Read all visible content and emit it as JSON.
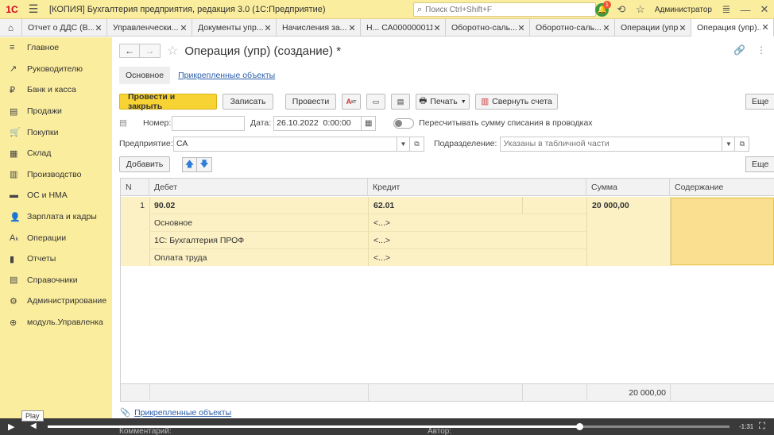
{
  "titlebar": {
    "logo": "1С",
    "title": "[КОПИЯ] Бухгалтерия предприятия, редакция 3.0  (1С:Предприятие)",
    "search_placeholder": "Поиск Ctrl+Shift+F",
    "notification_count": "1",
    "user": "Администратор"
  },
  "tabs": [
    {
      "label": "Отчет о ДДС (В..."
    },
    {
      "label": "Управленчески..."
    },
    {
      "label": "Документы упр..."
    },
    {
      "label": "Начисления за..."
    },
    {
      "label": "Н... СА000000011"
    },
    {
      "label": "Оборотно-саль..."
    },
    {
      "label": "Оборотно-саль..."
    },
    {
      "label": "Операции (упр)"
    },
    {
      "label": "Операция (упр)..."
    }
  ],
  "sidebar": {
    "items": [
      {
        "label": "Главное",
        "icon": "≡"
      },
      {
        "label": "Руководителю",
        "icon": "↗"
      },
      {
        "label": "Банк и касса",
        "icon": "₽"
      },
      {
        "label": "Продажи",
        "icon": "▤"
      },
      {
        "label": "Покупки",
        "icon": "🛒"
      },
      {
        "label": "Склад",
        "icon": "▦"
      },
      {
        "label": "Производство",
        "icon": "▥"
      },
      {
        "label": "ОС и НМА",
        "icon": "▬"
      },
      {
        "label": "Зарплата и кадры",
        "icon": "👤"
      },
      {
        "label": "Операции",
        "icon": "Aₖ"
      },
      {
        "label": "Отчеты",
        "icon": "▮"
      },
      {
        "label": "Справочники",
        "icon": "▤"
      },
      {
        "label": "Администрирование",
        "icon": "⚙"
      },
      {
        "label": "модуль.Управленка",
        "icon": "⊕"
      }
    ]
  },
  "form": {
    "title": "Операция (упр) (создание) *",
    "subnav_main": "Основное",
    "subnav_link": "Прикрепленные объекты",
    "toolbar": {
      "post_close": "Провести и закрыть",
      "save": "Записать",
      "post": "Провести",
      "print": "Печать",
      "collapse_accounts": "Свернуть счета",
      "more": "Еще"
    },
    "number_label": "Номер:",
    "number_value": "",
    "date_label": "Дата:",
    "date_value": "26.10.2022  0:00:00",
    "recalc_label": "Пересчитывать сумму списания в проводках",
    "org_label": "Предприятие:",
    "org_value": "СА",
    "dept_label": "Подразделение:",
    "dept_placeholder": "Указаны в табличной части",
    "add_button": "Добавить",
    "more2": "Еще"
  },
  "table": {
    "headers": {
      "n": "N",
      "debit": "Дебет",
      "credit": "Кредит",
      "sum": "Сумма",
      "content": "Содержание"
    },
    "row": {
      "n": "1",
      "debit_account": "90.02",
      "debit_sub": [
        "Основное",
        "1С: Бухгалтерия ПРОФ",
        "Оплата труда"
      ],
      "credit_account": "62.01",
      "credit_sub": [
        "<...>",
        "<...>",
        "<...>"
      ],
      "sum": "20 000,00"
    },
    "total": "20 000,00"
  },
  "attach_link": "Прикрепленные объекты",
  "footer_hidden": {
    "comment": "Комментарий:",
    "author": "Автор:"
  },
  "video": {
    "play_tooltip": "Play",
    "time": "-1:31",
    "progress": 0.78
  }
}
